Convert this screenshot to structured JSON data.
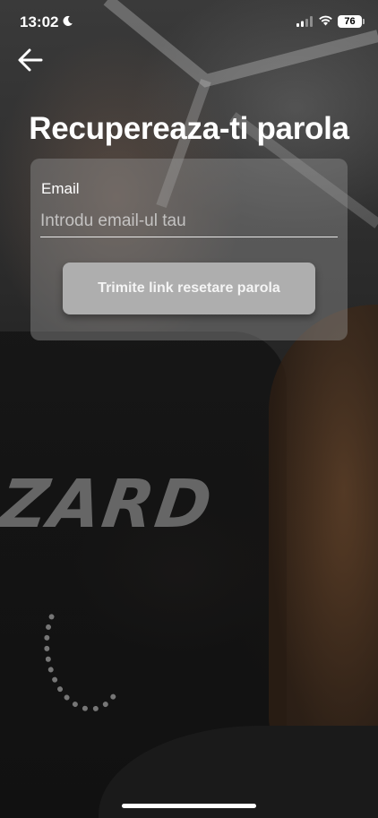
{
  "status_bar": {
    "time": "13:02",
    "battery": "76",
    "icons": [
      "moon-icon",
      "signal-icon",
      "wifi-icon",
      "battery-icon"
    ]
  },
  "header": {
    "back_icon": "arrow-left-icon",
    "title": "Recupereaza-ti parola"
  },
  "form": {
    "email_label": "Email",
    "email_value": "",
    "email_placeholder": "Introdu email-ul tau",
    "submit_label": "Trimite link resetare parola"
  },
  "background": {
    "shirt_text": "ZARD"
  },
  "colors": {
    "card_bg": "#969696",
    "button_bg": "#aeaeae",
    "text": "#ffffff"
  }
}
